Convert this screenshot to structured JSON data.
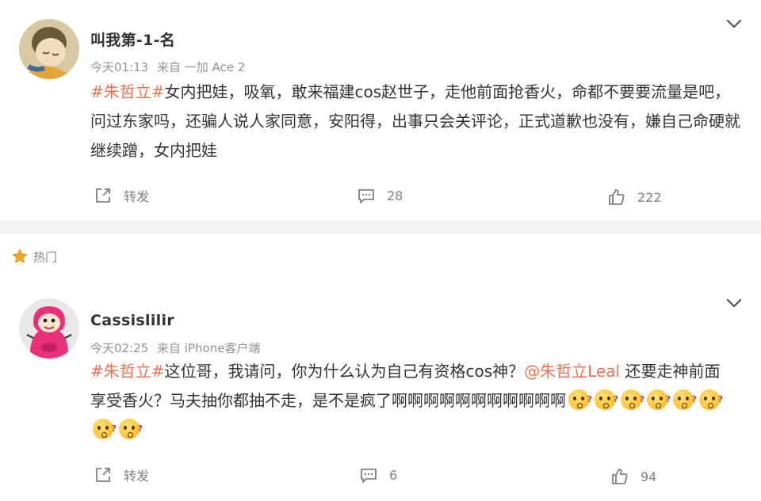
{
  "comments": [
    {
      "username": "叫我第-1-名",
      "time": "今天01:13",
      "source": "来自 一加 Ace 2",
      "topic": "#朱哲立#",
      "text": "女内把娃，吸氧，敢来福建cos赵世子，走他前面抢香火，命都不要要流量是吧，问过东家吗，还骗人说人家同意，安阳得，出事只会关评论，正式道歉也没有，嫌自己命硬就继续蹭，女内把娃",
      "repost_label": "转发",
      "comment_count": "28",
      "like_count": "222"
    },
    {
      "username": "Cassislilir",
      "time": "今天02:25",
      "source": "来自 iPhone客户端",
      "topic": "#朱哲立#",
      "text_part1": "这位哥，我请问，你为什么认为自己有资格cos神？",
      "mention": "@朱哲立Leal",
      "text_part2": " 还要走神前面享受香火？马夫抽你都抽不走，是不是疯了啊啊啊啊啊啊啊啊啊啊啊",
      "emoji_name": "doge-question-emoji",
      "emoji_count": 8,
      "repost_label": "转发",
      "comment_count": "6",
      "like_count": "94"
    }
  ],
  "hot_section": {
    "label": "热门"
  },
  "colors": {
    "accent": "#eb7350",
    "meta": "#939393",
    "divider": "#f2f2f2",
    "star": "#f5a623"
  }
}
